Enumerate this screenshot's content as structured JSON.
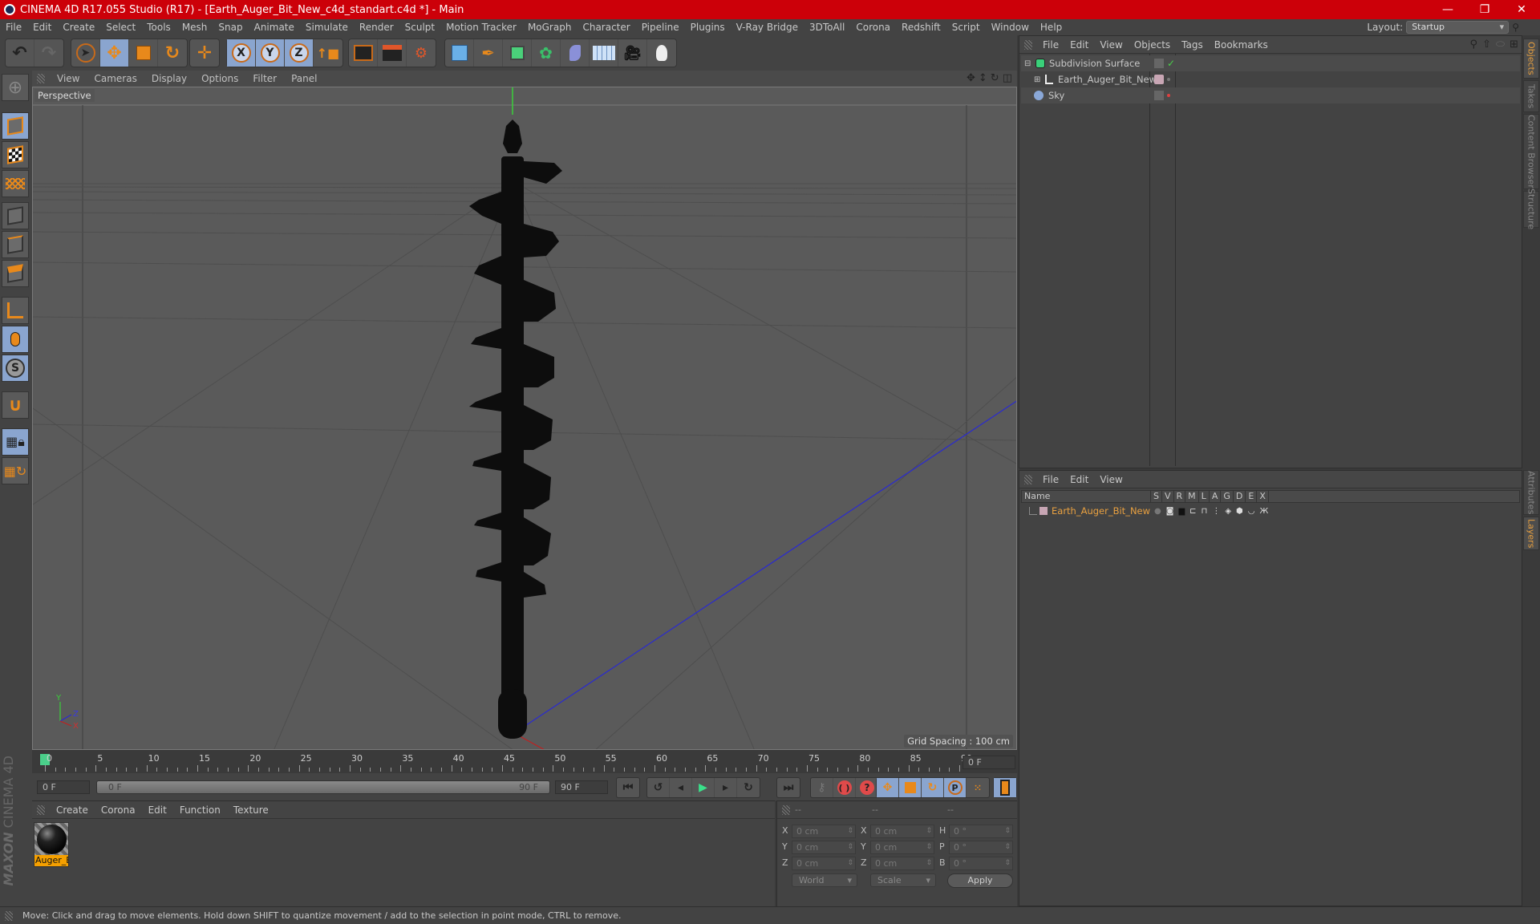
{
  "window": {
    "title": "CINEMA 4D R17.055 Studio (R17) - [Earth_Auger_Bit_New_c4d_standart.c4d *] - Main",
    "controls": {
      "minimize": "—",
      "restore": "❐",
      "close": "✕"
    }
  },
  "menubar": {
    "items": [
      "File",
      "Edit",
      "Create",
      "Select",
      "Tools",
      "Mesh",
      "Snap",
      "Animate",
      "Simulate",
      "Render",
      "Sculpt",
      "Motion Tracker",
      "MoGraph",
      "Character",
      "Pipeline",
      "Plugins",
      "V-Ray Bridge",
      "3DToAll",
      "Corona",
      "Redshift",
      "Script",
      "Window",
      "Help"
    ],
    "layout_label": "Layout:",
    "layout_value": "Startup"
  },
  "toolbar": {
    "undo": "↶",
    "redo": "↷",
    "tools": [
      "live-selection",
      "move",
      "scale",
      "rotate",
      "transform"
    ],
    "axes": [
      "X",
      "Y",
      "Z"
    ],
    "coord_system": "world-coordinates",
    "render": [
      "render-view",
      "render-to-picture-viewer",
      "render-settings"
    ],
    "create": [
      "cube",
      "pen-spline",
      "subdivision-surface",
      "array",
      "deformer",
      "floor",
      "camera",
      "light"
    ]
  },
  "left_tools": [
    "make-editable",
    "model-mode",
    "texture-mode",
    "workplane-mode",
    "points-mode",
    "edges-mode",
    "polygons-mode",
    "axis-mode",
    "tweak-mode",
    "soft-selection",
    "enable-snap",
    "locked-workplane",
    "workplane-alignment"
  ],
  "viewport": {
    "menu": [
      "View",
      "Cameras",
      "Display",
      "Options",
      "Filter",
      "Panel"
    ],
    "camera_label": "Perspective",
    "grid_spacing": "Grid Spacing : 100 cm",
    "axis_labels": {
      "y": "Y",
      "z": "Z",
      "x": "X"
    },
    "nav_icons": [
      "move-view",
      "zoom-view",
      "rotate-view",
      "maximize-view"
    ]
  },
  "timeline": {
    "ticks": [
      "0",
      "5",
      "10",
      "15",
      "20",
      "25",
      "30",
      "35",
      "40",
      "45",
      "50",
      "55",
      "60",
      "65",
      "70",
      "75",
      "80",
      "85",
      "90"
    ],
    "current_frame_field": "0 F",
    "start_field": "0 F",
    "range_start": "0 F",
    "range_end": "90 F",
    "end_field": "90 F",
    "current_frame": 0,
    "min_frame": 0,
    "max_frame": 90
  },
  "materials": {
    "menu": [
      "Create",
      "Corona",
      "Edit",
      "Function",
      "Texture"
    ],
    "items": [
      {
        "name": "Auger_E"
      }
    ]
  },
  "coordinates": {
    "headers": [
      "--",
      "--",
      "--"
    ],
    "rows": [
      {
        "l1": "X",
        "v1": "0 cm",
        "l2": "X",
        "v2": "0 cm",
        "l3": "H",
        "v3": "0 °"
      },
      {
        "l1": "Y",
        "v1": "0 cm",
        "l2": "Y",
        "v2": "0 cm",
        "l3": "P",
        "v3": "0 °"
      },
      {
        "l1": "Z",
        "v1": "0 cm",
        "l2": "Z",
        "v2": "0 cm",
        "l3": "B",
        "v3": "0 °"
      }
    ],
    "mode1": "World",
    "mode2": "Scale",
    "apply": "Apply"
  },
  "objects_panel": {
    "menu": [
      "File",
      "Edit",
      "View",
      "Objects",
      "Tags",
      "Bookmarks"
    ],
    "objects": [
      {
        "name": "Subdivision Surface",
        "icon": "subdivision-icon",
        "expand": "⊟",
        "check": "✓"
      },
      {
        "name": "Earth_Auger_Bit_New",
        "icon": "null-object-icon",
        "expand": "⊞",
        "tag_color": "#c8a6b4"
      },
      {
        "name": "Sky",
        "icon": "sky-icon"
      }
    ]
  },
  "layers_panel": {
    "menu": [
      "File",
      "Edit",
      "View"
    ],
    "columns": [
      "Name",
      "S",
      "V",
      "R",
      "M",
      "L",
      "A",
      "G",
      "D",
      "E",
      "X"
    ],
    "layers": [
      {
        "name": "Earth_Auger_Bit_New",
        "color": "#c8a6b4"
      }
    ]
  },
  "side_tabs": {
    "top": [
      "Objects",
      "Takes",
      "Content Browser",
      "Structure"
    ],
    "bottom": [
      "Attributes",
      "Layers"
    ]
  },
  "status": "Move: Click and drag to move elements. Hold down SHIFT to quantize movement / add to the selection in point mode, CTRL to remove.",
  "branding": {
    "maxon": "MAXON",
    "product": "CINEMA 4D"
  },
  "colors": {
    "title_bar": "#cc0009",
    "accent_orange": "#e8891b",
    "active_blue": "#8aa5cf",
    "selected_text": "#e8a040"
  }
}
